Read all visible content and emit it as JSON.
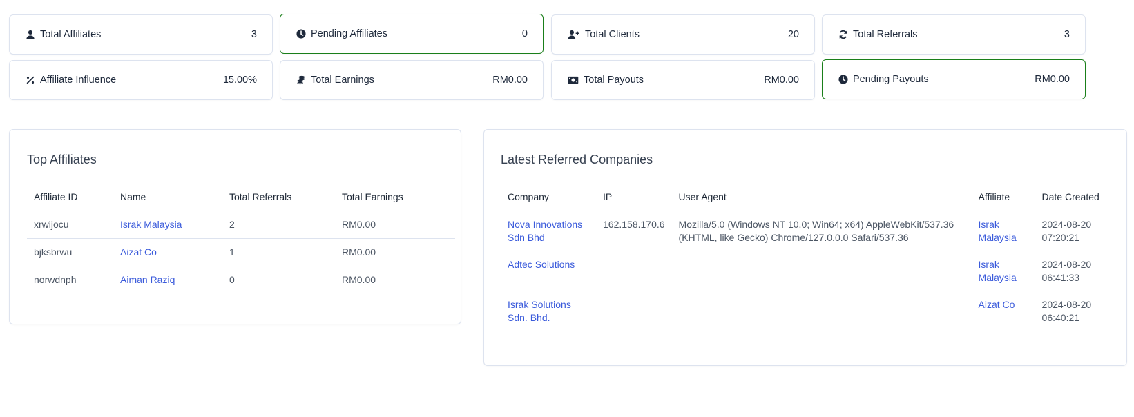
{
  "stats": [
    {
      "icon": "user-icon",
      "label": "Total Affiliates",
      "value": "3",
      "highlight": false
    },
    {
      "icon": "clock-icon",
      "label": "Pending Affiliates",
      "value": "0",
      "highlight": true
    },
    {
      "icon": "user-plus-icon",
      "label": "Total Clients",
      "value": "20",
      "highlight": false
    },
    {
      "icon": "refresh-icon",
      "label": "Total Referrals",
      "value": "3",
      "highlight": false
    },
    {
      "icon": "percent-icon",
      "label": "Affiliate Influence",
      "value": "15.00%",
      "highlight": false
    },
    {
      "icon": "coins-icon",
      "label": "Total Earnings",
      "value": "RM0.00",
      "highlight": false
    },
    {
      "icon": "money-bill-icon",
      "label": "Total Payouts",
      "value": "RM0.00",
      "highlight": false
    },
    {
      "icon": "clock-icon",
      "label": "Pending Payouts",
      "value": "RM0.00",
      "highlight": true
    }
  ],
  "colors": {
    "highlight_border": "#1a7f1a",
    "link": "#3b5bdb",
    "card_border": "#dde3ef"
  },
  "top_affiliates": {
    "title": "Top Affiliates",
    "columns": [
      "Affiliate ID",
      "Name",
      "Total Referrals",
      "Total Earnings"
    ],
    "rows": [
      {
        "id": "xrwijocu",
        "name": "Israk Malaysia",
        "referrals": "2",
        "earnings": "RM0.00"
      },
      {
        "id": "bjksbrwu",
        "name": "Aizat Co",
        "referrals": "1",
        "earnings": "RM0.00"
      },
      {
        "id": "norwdnph",
        "name": "Aiman Raziq",
        "referrals": "0",
        "earnings": "RM0.00"
      }
    ]
  },
  "latest_referred": {
    "title": "Latest Referred Companies",
    "columns": [
      "Company",
      "IP",
      "User Agent",
      "Affiliate",
      "Date Created"
    ],
    "rows": [
      {
        "company": "Nova Innovations Sdn Bhd",
        "ip": "162.158.170.6",
        "user_agent": "Mozilla/5.0 (Windows NT 10.0; Win64; x64) AppleWebKit/537.36 (KHTML, like Gecko) Chrome/127.0.0.0 Safari/537.36",
        "affiliate": "Israk Malaysia",
        "date": "2024-08-20 07:20:21"
      },
      {
        "company": "Adtec Solutions",
        "ip": "",
        "user_agent": "",
        "affiliate": "Israk Malaysia",
        "date": "2024-08-20 06:41:33"
      },
      {
        "company": "Israk Solutions Sdn. Bhd.",
        "ip": "",
        "user_agent": "",
        "affiliate": "Aizat Co",
        "date": "2024-08-20 06:40:21"
      }
    ]
  }
}
